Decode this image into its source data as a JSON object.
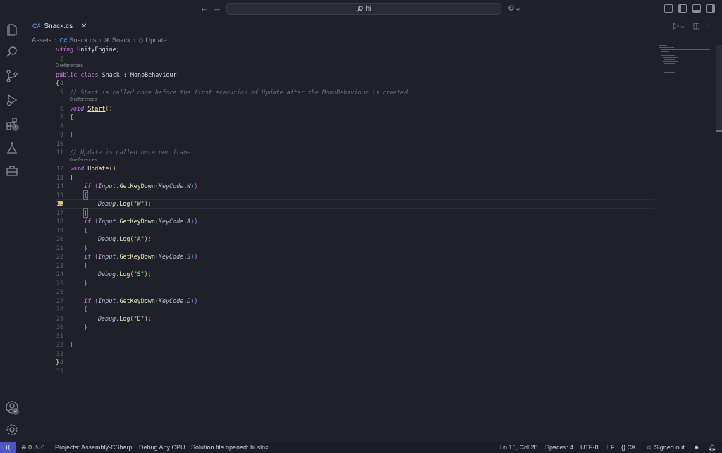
{
  "titlebar": {
    "search_value": "hi",
    "back_icon": "arrow-left-icon",
    "forward_icon": "arrow-right-icon"
  },
  "tab": {
    "label": "Snack.cs",
    "close": "✕"
  },
  "breadcrumb": {
    "items": [
      "Assets",
      "Snack.cs",
      "Snack",
      "Update"
    ]
  },
  "editor": {
    "active_line": 16,
    "codelens": "0 references",
    "lines": [
      {
        "n": "1"
      },
      {
        "n": "2"
      },
      {
        "n": "3"
      },
      {
        "n": "4"
      },
      {
        "n": "5"
      },
      {
        "n": "6"
      },
      {
        "n": "7"
      },
      {
        "n": "8"
      },
      {
        "n": "9"
      },
      {
        "n": "10"
      },
      {
        "n": "11"
      },
      {
        "n": "12"
      },
      {
        "n": "13"
      },
      {
        "n": "14"
      },
      {
        "n": "15"
      },
      {
        "n": "16"
      },
      {
        "n": "17"
      },
      {
        "n": "18"
      },
      {
        "n": "19"
      },
      {
        "n": "20"
      },
      {
        "n": "21"
      },
      {
        "n": "22"
      },
      {
        "n": "23"
      },
      {
        "n": "24"
      },
      {
        "n": "25"
      },
      {
        "n": "26"
      },
      {
        "n": "27"
      },
      {
        "n": "28"
      },
      {
        "n": "29"
      },
      {
        "n": "30"
      },
      {
        "n": "31"
      },
      {
        "n": "32"
      },
      {
        "n": "33"
      },
      {
        "n": "34"
      },
      {
        "n": "35"
      }
    ],
    "code": {
      "using": "using",
      "unity_engine": "UnityEngine",
      "semicolon": ";",
      "public": "public",
      "class": "class",
      "class_name": "Snack",
      "colon": ":",
      "base": "MonoBehaviour",
      "comment_start": "// Start is called once before the first execution of Update after the MonoBehaviour is created",
      "void": "void",
      "start": "Start",
      "comment_update": "// Update is called once per frame",
      "update": "Update",
      "parens": "()",
      "if": "if",
      "input": "Input",
      "get_key_down": "GetKeyDown",
      "keycode": "KeyCode",
      "debug": "Debug",
      "log": "Log",
      "keys": [
        "W",
        "A",
        "S",
        "D"
      ],
      "strings": [
        "\"W\"",
        "\"A\"",
        "\"S\"",
        "\"D\""
      ]
    }
  },
  "activity_bar": {
    "icons": [
      "explorer-icon",
      "search-icon",
      "source-control-icon",
      "run-debug-icon",
      "extensions-icon",
      "testing-icon",
      "remote-explorer-icon",
      "accounts-icon",
      "settings-icon"
    ],
    "extensions_badge": "1"
  },
  "statusbar": {
    "errors": "0",
    "warnings": "0",
    "project": "Projects: Assembly-CSharp",
    "config": "Debug Any CPU",
    "solution": "Solution file opened: hi.slnx",
    "position": "Ln 16, Col 28",
    "spaces": "Spaces: 4",
    "encoding": "UTF-8",
    "eol": "LF",
    "language": "C#",
    "signed_out": "Signed out"
  }
}
